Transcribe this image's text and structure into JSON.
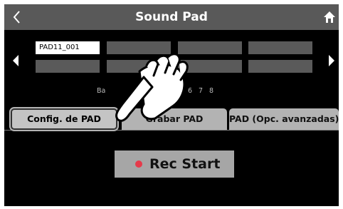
{
  "header": {
    "title": "Sound Pad",
    "back_icon": "chevron-left-icon",
    "home_icon": "home-icon"
  },
  "pads": {
    "selected_label": "PAD11_001",
    "prev_icon": "triangle-left-icon",
    "next_icon": "triangle-right-icon"
  },
  "bank": {
    "label": "Ba",
    "numbers": [
      "4",
      "5",
      "6",
      "7",
      "8"
    ]
  },
  "tabs": [
    {
      "label": "Config. de PAD",
      "active": true
    },
    {
      "label": "Grabar PAD",
      "active": false
    },
    {
      "label": "PAD (Opc. avanzadas)",
      "active": false
    }
  ],
  "record": {
    "label": "Rec Start",
    "dot_color": "#e63a4a"
  },
  "overlay": {
    "icon": "pointing-hand-icon"
  },
  "colors": {
    "screen_bg": "#000000",
    "titlebar": "#595959",
    "pad_empty": "#5a5a5a",
    "pad_selected": "#ffffff",
    "tab": "#b3b3b3",
    "button": "#a6a6a6"
  }
}
